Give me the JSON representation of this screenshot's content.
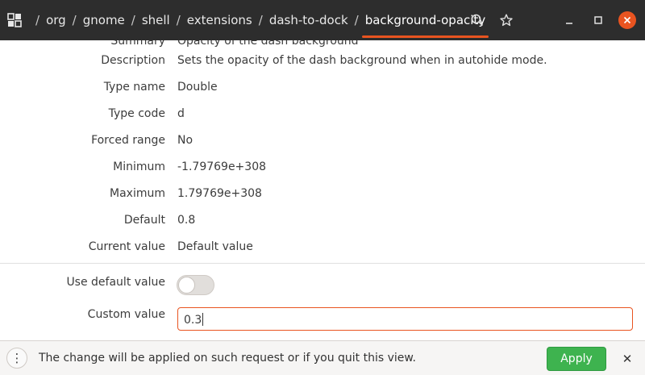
{
  "header": {
    "breadcrumbs": [
      "org",
      "gnome",
      "shell",
      "extensions",
      "dash-to-dock",
      "background-opacity"
    ],
    "separator": "/"
  },
  "properties": {
    "summary": {
      "label": "Summary",
      "value": "Opacity of the dash background"
    },
    "description": {
      "label": "Description",
      "value": "Sets the opacity of the dash background when in autohide mode."
    },
    "type_name": {
      "label": "Type name",
      "value": "Double"
    },
    "type_code": {
      "label": "Type code",
      "value": "d"
    },
    "forced_range": {
      "label": "Forced range",
      "value": "No"
    },
    "minimum": {
      "label": "Minimum",
      "value": "-1.79769e+308"
    },
    "maximum": {
      "label": "Maximum",
      "value": "1.79769e+308"
    },
    "default": {
      "label": "Default",
      "value": "0.8"
    },
    "current_value": {
      "label": "Current value",
      "value": "Default value"
    }
  },
  "settings": {
    "use_default_label": "Use default value",
    "use_default_state": "off",
    "custom_value_label": "Custom value",
    "custom_value": "0.3"
  },
  "infobar": {
    "message": "The change will be applied on such request or if you quit this view.",
    "apply_label": "Apply",
    "dismiss_glyph": "✕",
    "menu_glyph": "⋮"
  },
  "colors": {
    "header_bg": "#2d2d2d",
    "accent": "#e95420",
    "apply_green": "#3eb34f"
  }
}
